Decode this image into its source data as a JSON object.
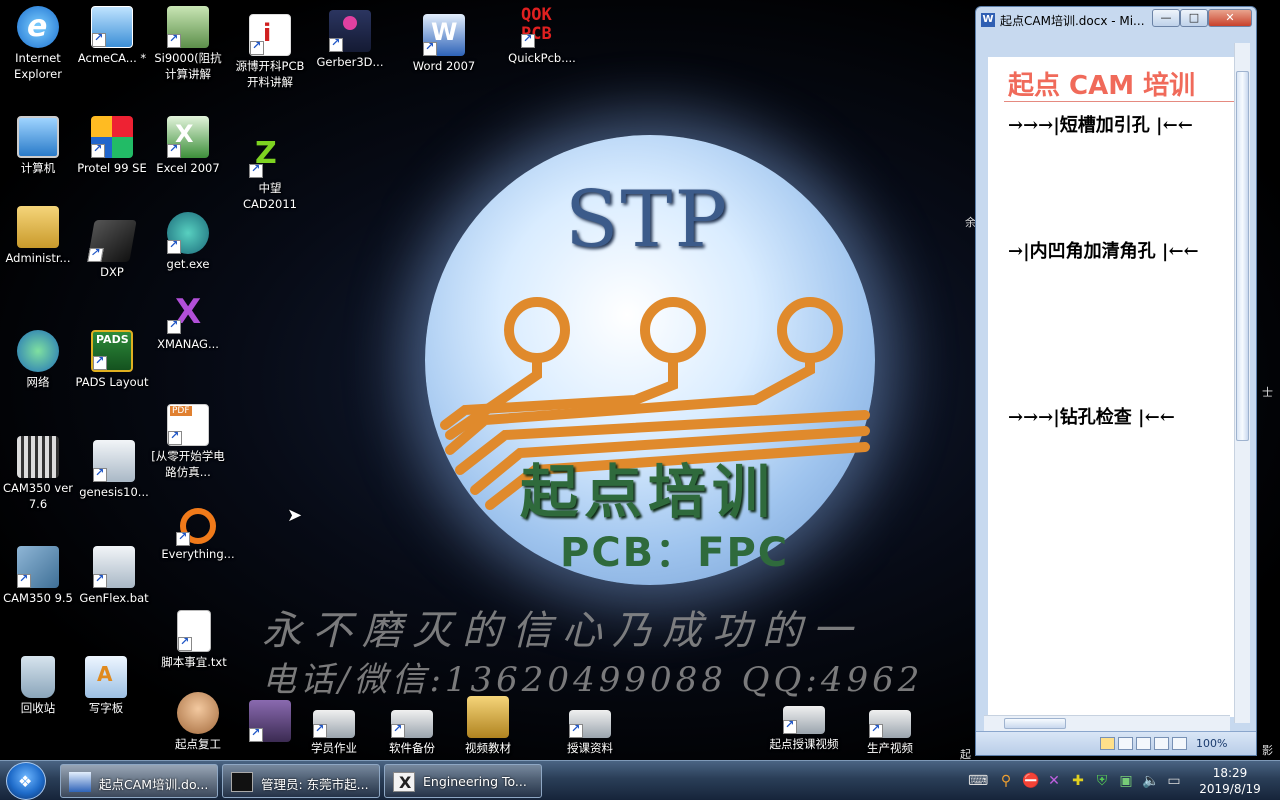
{
  "desktop": {
    "icons": [
      {
        "label": "Internet Explorer"
      },
      {
        "label": "AcmeCA... *"
      },
      {
        "label": "Si9000(阻抗计算讲解"
      },
      {
        "label": "源博开科PCB开料讲解"
      },
      {
        "label": "Gerber3D..."
      },
      {
        "label": "Word 2007"
      },
      {
        "label": "QuickPcb...."
      },
      {
        "label": "计算机"
      },
      {
        "label": "Protel 99 SE"
      },
      {
        "label": "Excel 2007"
      },
      {
        "label": "中望CAD2011"
      },
      {
        "label": "Administr..."
      },
      {
        "label": "DXP"
      },
      {
        "label": "get.exe"
      },
      {
        "label": "XMANAG..."
      },
      {
        "label": "网络"
      },
      {
        "label": "PADS Layout"
      },
      {
        "label": "[从零开始学电路仿真..."
      },
      {
        "label": "CAM350 ver 7.6"
      },
      {
        "label": "genesis10..."
      },
      {
        "label": "Everything..."
      },
      {
        "label": "CAM350 9.5"
      },
      {
        "label": "GenFlex.bat"
      },
      {
        "label": "脚本事宜.txt"
      },
      {
        "label": "回收站"
      },
      {
        "label": "写字板"
      },
      {
        "label": "起点复工"
      },
      {
        "label": "学员作业"
      },
      {
        "label": "软件备份"
      },
      {
        "label": "视频教材"
      },
      {
        "label": "授课资料"
      },
      {
        "label": "起点授课视频"
      },
      {
        "label": "生产视频"
      }
    ],
    "wallpaper": {
      "logo_text": "STP",
      "title": "起点培训",
      "subtitle": "PCB：FPC",
      "slogan": "永不磨灭的信心乃成功的一",
      "contact": "电话/微信:13620499088 QQ:4962"
    },
    "edge_text": {
      "right_top": "余",
      "right_mid": "士",
      "right_bottom_1": "起",
      "right_bottom_2": "影"
    }
  },
  "word_window": {
    "title": "起点CAM培训.docx - Mi...",
    "doc_heading": "起点 CAM 培训",
    "lines": [
      "→→→|短槽加引孔 |←←",
      "→|内凹角加清角孔 |←←",
      "→→→|钻孔检查 |←←"
    ],
    "zoom": "100%",
    "controls": {
      "minimize": "—",
      "maximize": "□",
      "close": "✕"
    }
  },
  "taskbar": {
    "tasks": [
      {
        "label": "起点CAM培训.do...",
        "icon": "word-icon"
      },
      {
        "label": "管理员: 东莞市起...",
        "icon": "cmd-icon"
      },
      {
        "label": "Engineering To...",
        "icon": "xmanager-icon"
      }
    ],
    "clock_time": "18:29",
    "clock_date": "2019/8/19"
  },
  "colors": {
    "taskbar": "#2a3e57",
    "word_frame": "#c7d9ef",
    "doc_heading": "#f06a5a"
  }
}
